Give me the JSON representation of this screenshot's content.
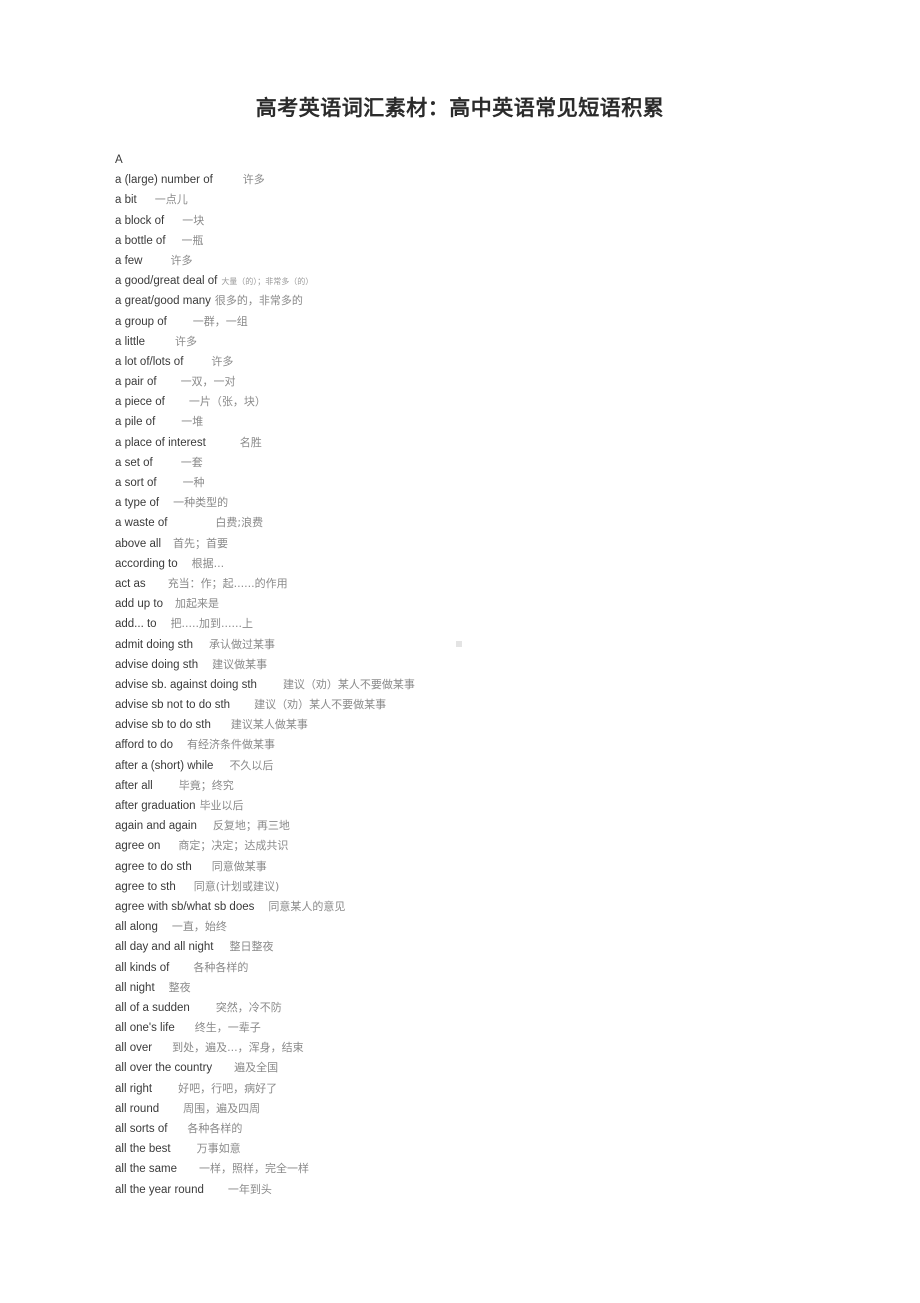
{
  "document": {
    "title": "高考英语词汇素材：高中英语常见短语积累",
    "section_letter": "A"
  },
  "entries": [
    {
      "en": "a (large) number of",
      "gap": 30,
      "cn": "许多",
      "size": "normal"
    },
    {
      "en": "a bit",
      "gap": 18,
      "cn": "一点儿",
      "size": "normal"
    },
    {
      "en": "a block of",
      "gap": 18,
      "cn": "一块",
      "size": "normal"
    },
    {
      "en": "a bottle of",
      "gap": 16,
      "cn": "一瓶",
      "size": "normal"
    },
    {
      "en": "a few",
      "gap": 28,
      "cn": "许多",
      "size": "normal"
    },
    {
      "en": "a good/great deal of",
      "gap": 4,
      "cn": "大量（的）；非常多（的）",
      "size": "tiny"
    },
    {
      "en": "a great/good   many",
      "gap": 4,
      "cn": "很多的，非常多的",
      "size": "normal"
    },
    {
      "en": "a group of",
      "gap": 26,
      "cn": "一群，一组",
      "size": "normal"
    },
    {
      "en": "a little",
      "gap": 30,
      "cn": "许多",
      "size": "normal"
    },
    {
      "en": "a lot of/lots of",
      "gap": 28,
      "cn": "许多",
      "size": "normal"
    },
    {
      "en": "a pair of",
      "gap": 24,
      "cn": "一双，一对",
      "size": "normal"
    },
    {
      "en": "a piece of",
      "gap": 24,
      "cn": "一片（张，块）",
      "size": "normal"
    },
    {
      "en": "a pile of",
      "gap": 26,
      "cn": "一堆",
      "size": "normal"
    },
    {
      "en": "a place of interest",
      "gap": 34,
      "cn": "名胜",
      "size": "normal"
    },
    {
      "en": "a set of",
      "gap": 28,
      "cn": "一套",
      "size": "normal"
    },
    {
      "en": "a sort of",
      "gap": 26,
      "cn": "一种",
      "size": "normal"
    },
    {
      "en": "a type of",
      "gap": 14,
      "cn": "一种类型的",
      "size": "normal"
    },
    {
      "en": "a waste of",
      "gap": 48,
      "cn": "白费;浪费",
      "size": "normal"
    },
    {
      "en": "above all",
      "gap": 12,
      "cn": "首先；首要",
      "size": "normal"
    },
    {
      "en": "according   to",
      "gap": 14,
      "cn": "根据...",
      "size": "normal"
    },
    {
      "en": "act as",
      "gap": 22,
      "cn": "充当：作；起......的作用",
      "size": "normal"
    },
    {
      "en": "add up to",
      "gap": 12,
      "cn": "加起来是",
      "size": "normal"
    },
    {
      "en": "add... to",
      "gap": 14,
      "cn": "把.....加到......上",
      "size": "normal"
    },
    {
      "en": "admit doing sth",
      "gap": 16,
      "cn": "承认做过某事",
      "size": "normal"
    },
    {
      "en": "advise   doing sth",
      "gap": 14,
      "cn": "建议做某事",
      "size": "normal"
    },
    {
      "en": "advise sb. against doing sth",
      "gap": 26,
      "cn": "建议（劝）某人不要做某事",
      "size": "normal"
    },
    {
      "en": "advise sb not to do sth",
      "gap": 24,
      "cn": "建议（劝）某人不要做某事",
      "size": "normal"
    },
    {
      "en": "advise sb to do sth",
      "gap": 20,
      "cn": "建议某人做某事",
      "size": "normal"
    },
    {
      "en": "afford to do",
      "gap": 14,
      "cn": "有经济条件做某事",
      "size": "normal"
    },
    {
      "en": "after a (short) while",
      "gap": 16,
      "cn": "不久以后",
      "size": "normal"
    },
    {
      "en": "after all",
      "gap": 26,
      "cn": "毕竟；终究",
      "size": "normal"
    },
    {
      "en": "after graduation",
      "gap": 4,
      "cn": "毕业以后",
      "size": "normal"
    },
    {
      "en": "again and again",
      "gap": 16,
      "cn": "反复地；再三地",
      "size": "normal"
    },
    {
      "en": "agree on",
      "gap": 18,
      "cn": "商定；决定；达成共识",
      "size": "normal"
    },
    {
      "en": "agree to do sth",
      "gap": 20,
      "cn": "同意做某事",
      "size": "normal"
    },
    {
      "en": "agree to sth",
      "gap": 18,
      "cn": "同意(计划或建议)",
      "size": "normal"
    },
    {
      "en": "agree with sb/what sb does",
      "gap": 14,
      "cn": "同意某人的意见",
      "size": "normal"
    },
    {
      "en": "all along",
      "gap": 14,
      "cn": "一直，始终",
      "size": "normal"
    },
    {
      "en": "all day and all night",
      "gap": 16,
      "cn": "整日整夜",
      "size": "normal"
    },
    {
      "en": "all kinds of",
      "gap": 24,
      "cn": "各种各样的",
      "size": "normal"
    },
    {
      "en": "all night",
      "gap": 14,
      "cn": "整夜",
      "size": "normal"
    },
    {
      "en": "all of a sudden",
      "gap": 26,
      "cn": "突然，冷不防",
      "size": "normal"
    },
    {
      "en": "all one's life",
      "gap": 20,
      "cn": "终生，一辈子",
      "size": "normal"
    },
    {
      "en": "all over",
      "gap": 20,
      "cn": "到处，遍及...，浑身，结束",
      "size": "normal"
    },
    {
      "en": "all over the country",
      "gap": 22,
      "cn": "遍及全国",
      "size": "normal"
    },
    {
      "en": "all right",
      "gap": 26,
      "cn": "好吧，行吧，病好了",
      "size": "normal"
    },
    {
      "en": "all round",
      "gap": 24,
      "cn": "周围，遍及四周",
      "size": "normal"
    },
    {
      "en": "all sorts of",
      "gap": 20,
      "cn": "各种各样的",
      "size": "normal"
    },
    {
      "en": "all the best",
      "gap": 26,
      "cn": "万事如意",
      "size": "normal"
    },
    {
      "en": "all the same",
      "gap": 22,
      "cn": "一样，照样，完全一样",
      "size": "normal"
    },
    {
      "en": "all the year round",
      "gap": 24,
      "cn": "一年到头",
      "size": "normal"
    }
  ]
}
